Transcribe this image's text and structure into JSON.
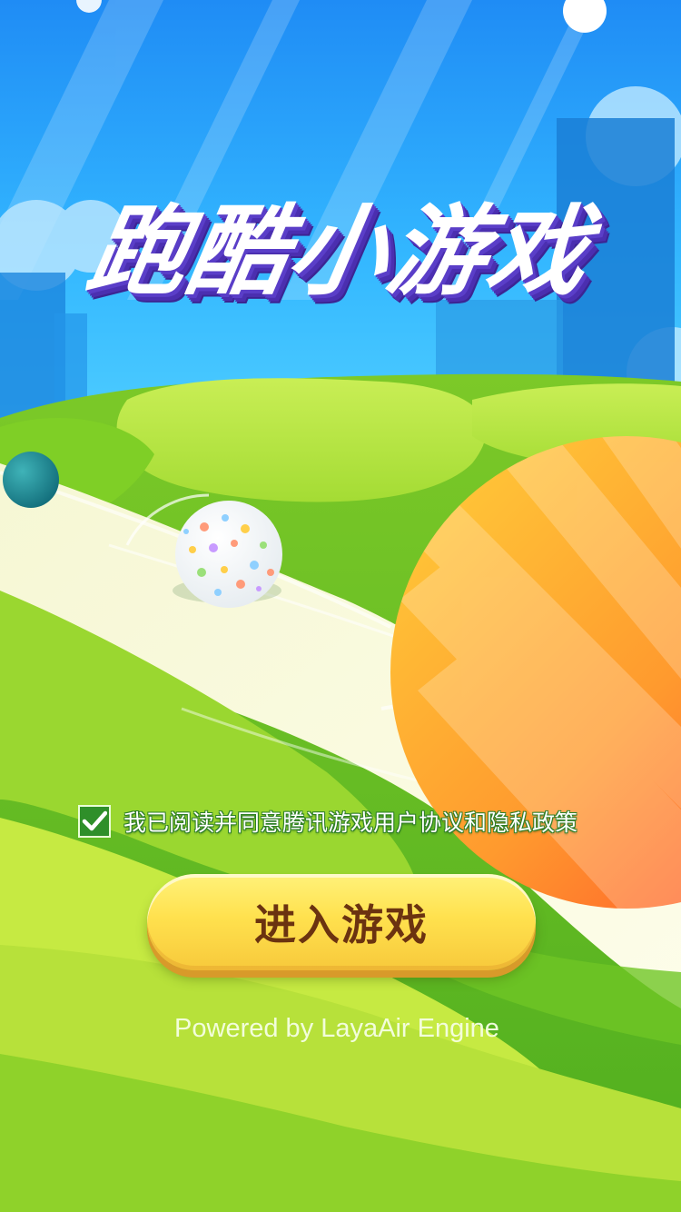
{
  "title": "跑酷小游戏",
  "agreement": {
    "checked": true,
    "text": "我已阅读并同意腾讯游戏用户协议和隐私政策"
  },
  "enter_button": {
    "label": "进入游戏"
  },
  "footer": {
    "powered_by": "Powered by LayaAir Engine"
  },
  "colors": {
    "sky": "#2a9bff",
    "grass": "#8fd22a",
    "path": "#fbf9d8",
    "button": "#ffe14e",
    "button_text": "#6b3310",
    "title_shadow": "#5a3ec8",
    "checkbox": "#2f8f2a"
  },
  "icons": {
    "checkbox": "check-icon"
  }
}
